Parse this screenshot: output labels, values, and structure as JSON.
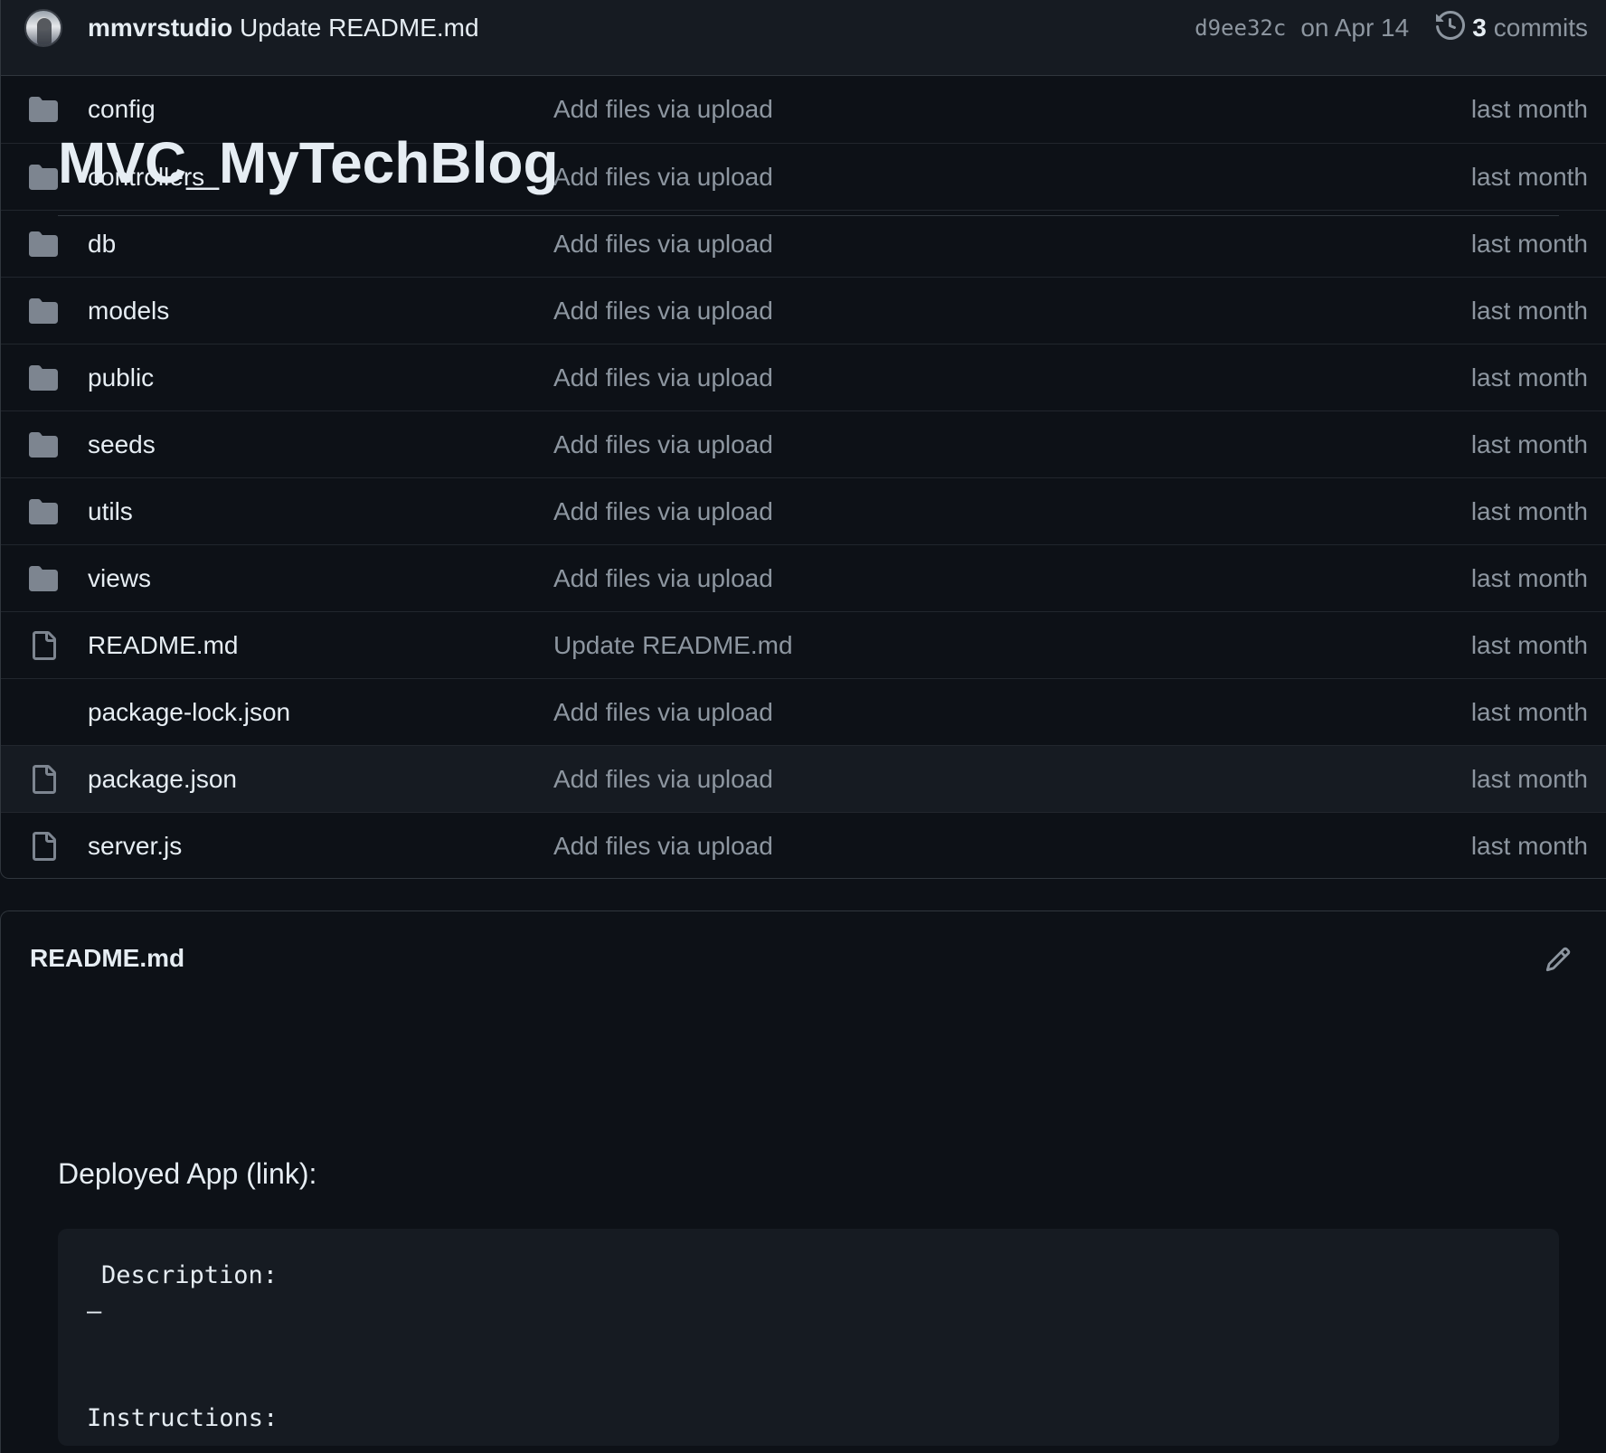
{
  "commit": {
    "author": "mmvrstudio",
    "message": "Update README.md",
    "sha": "d9ee32c",
    "date": "on Apr 14",
    "commits_count": "3",
    "commits_label": "commits"
  },
  "files": [
    {
      "type": "folder",
      "name": "config",
      "message": "Add files via upload",
      "time": "last month"
    },
    {
      "type": "folder",
      "name": "controllers",
      "message": "Add files via upload",
      "time": "last month"
    },
    {
      "type": "folder",
      "name": "db",
      "message": "Add files via upload",
      "time": "last month"
    },
    {
      "type": "folder",
      "name": "models",
      "message": "Add files via upload",
      "time": "last month"
    },
    {
      "type": "folder",
      "name": "public",
      "message": "Add files via upload",
      "time": "last month"
    },
    {
      "type": "folder",
      "name": "seeds",
      "message": "Add files via upload",
      "time": "last month"
    },
    {
      "type": "folder",
      "name": "utils",
      "message": "Add files via upload",
      "time": "last month"
    },
    {
      "type": "folder",
      "name": "views",
      "message": "Add files via upload",
      "time": "last month"
    },
    {
      "type": "file",
      "name": "README.md",
      "message": "Update README.md",
      "time": "last month"
    },
    {
      "type": "file",
      "name": "package-lock.json",
      "message": "Add files via upload",
      "time": "last month"
    },
    {
      "type": "file",
      "name": "package.json",
      "message": "Add files via upload",
      "time": "last month"
    },
    {
      "type": "file",
      "name": "server.js",
      "message": "Add files via upload",
      "time": "last month"
    }
  ],
  "readme": {
    "filename": "README.md",
    "title": "MVC_MyTechBlog",
    "deployed_line": "Deployed App (link):",
    "code_lines": [
      "Description:",
      "–",
      "Instructions:"
    ]
  },
  "colors": {
    "background": "#0d1117",
    "header_bg": "#161b22",
    "text_primary": "#e6edf3",
    "text_muted": "#8d96a0",
    "icon_folder": "#7d8590",
    "border": "#30363d"
  },
  "icons": {
    "folder": "folder-icon",
    "file": "file-icon",
    "history": "history-icon",
    "edit": "pencil-icon"
  }
}
